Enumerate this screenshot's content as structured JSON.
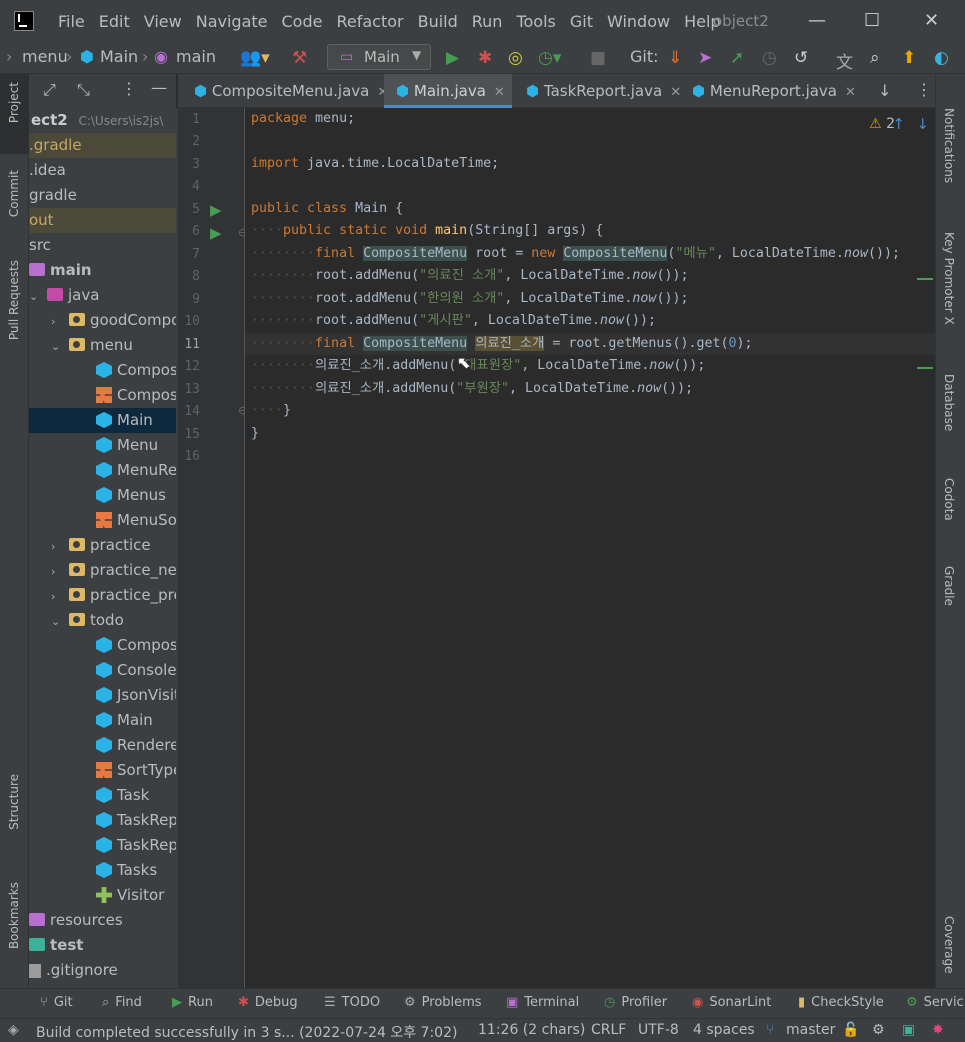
{
  "menubar": {
    "items": [
      "File",
      "Edit",
      "View",
      "Navigate",
      "Code",
      "Refactor",
      "Build",
      "Run",
      "Tools",
      "Git",
      "Window",
      "Help"
    ],
    "project_title": "object2"
  },
  "toolbar": {
    "breadcrumb": [
      "menu",
      "Main",
      "main"
    ],
    "run_config": "Main",
    "git_label": "Git:"
  },
  "left_stripe": [
    "Project",
    "Commit",
    "Pull Requests",
    "Structure",
    "Bookmarks"
  ],
  "right_stripe": [
    "Notifications",
    "Key Promoter X",
    "Database",
    "Codota",
    "Gradle",
    "Coverage"
  ],
  "project": {
    "root_name": "ect2",
    "root_path": "C:\\Users\\is2js\\",
    "tree": [
      {
        "label": ".gradle",
        "icon": "folder",
        "depth": 0,
        "chev": "",
        "hl": true
      },
      {
        "label": ".idea",
        "icon": "folder",
        "depth": 0,
        "chev": ""
      },
      {
        "label": "gradle",
        "icon": "folder",
        "depth": 0,
        "chev": ""
      },
      {
        "label": "out",
        "icon": "folder",
        "depth": 0,
        "chev": "",
        "hl": true
      },
      {
        "label": "src",
        "icon": "folder",
        "depth": 0,
        "chev": ""
      },
      {
        "label": "main",
        "icon": "main-root",
        "depth": 0,
        "chev": "",
        "bold": true
      },
      {
        "label": "java",
        "icon": "java-root",
        "depth": 1,
        "chev": "v"
      },
      {
        "label": "goodCompo",
        "icon": "pkg",
        "depth": 2,
        "chev": ">"
      },
      {
        "label": "menu",
        "icon": "pkg",
        "depth": 2,
        "chev": "v"
      },
      {
        "label": "Compos",
        "icon": "cls",
        "depth": 3,
        "chev": ""
      },
      {
        "label": "Compos",
        "icon": "iface",
        "depth": 3,
        "chev": ""
      },
      {
        "label": "Main",
        "icon": "cls",
        "depth": 3,
        "chev": "",
        "sel": true
      },
      {
        "label": "Menu",
        "icon": "cls",
        "depth": 3,
        "chev": ""
      },
      {
        "label": "MenuRe",
        "icon": "cls",
        "depth": 3,
        "chev": ""
      },
      {
        "label": "Menus",
        "icon": "cls",
        "depth": 3,
        "chev": ""
      },
      {
        "label": "MenuSo",
        "icon": "iface",
        "depth": 3,
        "chev": ""
      },
      {
        "label": "practice",
        "icon": "pkg",
        "depth": 2,
        "chev": ">"
      },
      {
        "label": "practice_nex",
        "icon": "pkg",
        "depth": 2,
        "chev": ">"
      },
      {
        "label": "practice_pre",
        "icon": "pkg",
        "depth": 2,
        "chev": ">"
      },
      {
        "label": "todo",
        "icon": "pkg",
        "depth": 2,
        "chev": "v"
      },
      {
        "label": "Compos",
        "icon": "cls",
        "depth": 3,
        "chev": ""
      },
      {
        "label": "Console",
        "icon": "cls",
        "depth": 3,
        "chev": ""
      },
      {
        "label": "JsonVisit",
        "icon": "cls",
        "depth": 3,
        "chev": ""
      },
      {
        "label": "Main",
        "icon": "cls",
        "depth": 3,
        "chev": ""
      },
      {
        "label": "Rendere",
        "icon": "cls",
        "depth": 3,
        "chev": ""
      },
      {
        "label": "SortType",
        "icon": "iface",
        "depth": 3,
        "chev": ""
      },
      {
        "label": "Task",
        "icon": "cls",
        "depth": 3,
        "chev": ""
      },
      {
        "label": "TaskRep",
        "icon": "cls",
        "depth": 3,
        "chev": ""
      },
      {
        "label": "TaskRep",
        "icon": "cls",
        "depth": 3,
        "chev": ""
      },
      {
        "label": "Tasks",
        "icon": "cls",
        "depth": 3,
        "chev": ""
      },
      {
        "label": "Visitor",
        "icon": "visitor",
        "depth": 3,
        "chev": ""
      },
      {
        "label": "resources",
        "icon": "res",
        "depth": 1,
        "chev": ""
      },
      {
        "label": "test",
        "icon": "test-root",
        "depth": 0,
        "chev": "",
        "bold": true
      },
      {
        "label": ".gitignore",
        "icon": "file",
        "depth": 0,
        "chev": ""
      }
    ]
  },
  "tabs": [
    {
      "label": "CompositeMenu.java",
      "active": false
    },
    {
      "label": "Main.java",
      "active": true
    },
    {
      "label": "TaskReport.java",
      "active": false
    },
    {
      "label": "MenuReport.java",
      "active": false
    }
  ],
  "editor": {
    "line_numbers": [
      "1",
      "2",
      "3",
      "4",
      "5",
      "6",
      "7",
      "8",
      "9",
      "10",
      "11",
      "12",
      "13",
      "14",
      "15",
      "16"
    ],
    "warning_count": "2",
    "lines": {
      "l1_kw": "package",
      "l1_rest": " menu;",
      "l3_kw": "import",
      "l3_rest": " java.time.LocalDateTime;",
      "l5_kw": "public class",
      "l5_rest": " Main {",
      "l6_kw": "public static void",
      "l6_fn": "main",
      "l6_rest": "(String[] args) {",
      "l7_kw": "final",
      "l7_type": "CompositeMenu",
      "l7_mid": " root = ",
      "l7_new": "new",
      "l7_type2": "CompositeMenu",
      "l7_str": "\"메뉴\"",
      "l7_end": ", LocalDateTime.",
      "l7_now": "now",
      "l7_tail": "());",
      "l8_head": "root.addMenu(",
      "l8_str": "\"의료진 소개\"",
      "l8_end": ", LocalDateTime.",
      "l8_now": "now",
      "l8_tail": "());",
      "l9_head": "root.addMenu(",
      "l9_str": "\"한의원 소개\"",
      "l9_end": ", LocalDateTime.",
      "l9_now": "now",
      "l9_tail": "());",
      "l10_head": "root.addMenu(",
      "l10_str": "\"게시판\"",
      "l10_end": ", LocalDateTime.",
      "l10_now": "now",
      "l10_tail": "());",
      "l11_kw": "final",
      "l11_type": "CompositeMenu",
      "l11_var": "의료진_소개",
      "l11_mid": " = root.getMenus().get(",
      "l11_num": "0",
      "l11_tail": ");",
      "l12_head": "의료진_소개.addMenu(",
      "l12_str": "\"대표원장\"",
      "l12_end": ", LocalDateTime.",
      "l12_now": "now",
      "l12_tail": "());",
      "l13_head": "의료진_소개.addMenu(",
      "l13_str": "\"부원장\"",
      "l13_end": ", LocalDateTime.",
      "l13_now": "now",
      "l13_tail": "());",
      "l14": "}",
      "l15": "}"
    }
  },
  "bottom_tools": [
    "Git",
    "Find",
    "Run",
    "Debug",
    "TODO",
    "Problems",
    "Terminal",
    "Profiler",
    "SonarLint",
    "CheckStyle",
    "Servic"
  ],
  "status": {
    "message": "Build completed successfully in 3 s... (2022-07-24 오후 7:02)",
    "position": "11:26 (2 chars)",
    "line_sep": "CRLF",
    "encoding": "UTF-8",
    "indent": "4 spaces",
    "branch": "master"
  },
  "colors": {
    "accent": "#4a88c7",
    "keyword": "#cc7832",
    "string": "#6a8759",
    "run_green": "#499c54"
  }
}
